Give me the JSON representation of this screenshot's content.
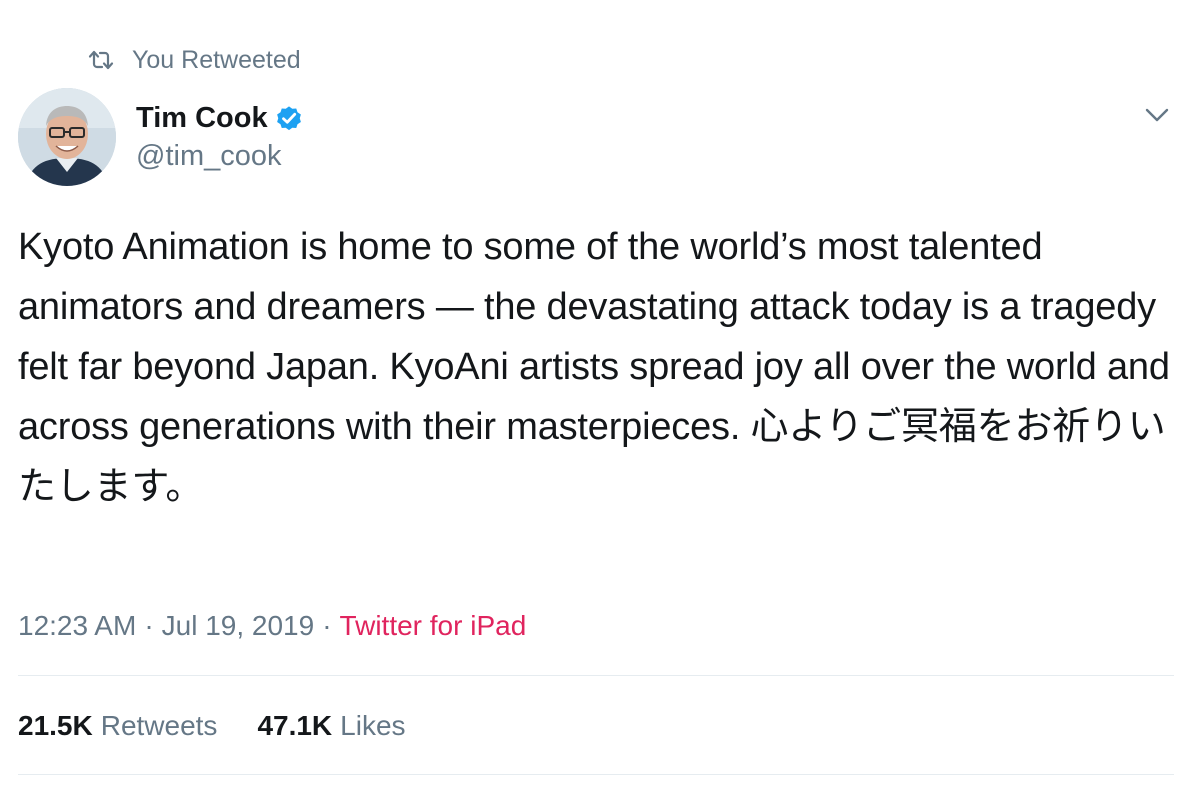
{
  "retweet_banner": {
    "label": "You Retweeted",
    "icon": "retweet-icon"
  },
  "author": {
    "display_name": "Tim Cook",
    "handle": "@tim_cook",
    "verified": true,
    "verified_color": "#1da1f2"
  },
  "tweet": {
    "text": "Kyoto Animation is home to some of the world’s most talented animators and dreamers — the devastating attack today is a tragedy felt far beyond Japan. KyoAni artists spread joy all over the world and across generations with their masterpieces. 心よりご冥福をお祈りいたします。",
    "time": "12:23 AM",
    "separator": "·",
    "date": "Jul 19, 2019",
    "source": "Twitter for iPad",
    "source_color": "#e0245e"
  },
  "stats": {
    "retweets_count": "21.5K",
    "retweets_label": "Retweets",
    "likes_count": "47.1K",
    "likes_label": "Likes"
  },
  "colors": {
    "text_primary": "#14171a",
    "text_secondary": "#657786",
    "divider": "#e6ecf0"
  }
}
